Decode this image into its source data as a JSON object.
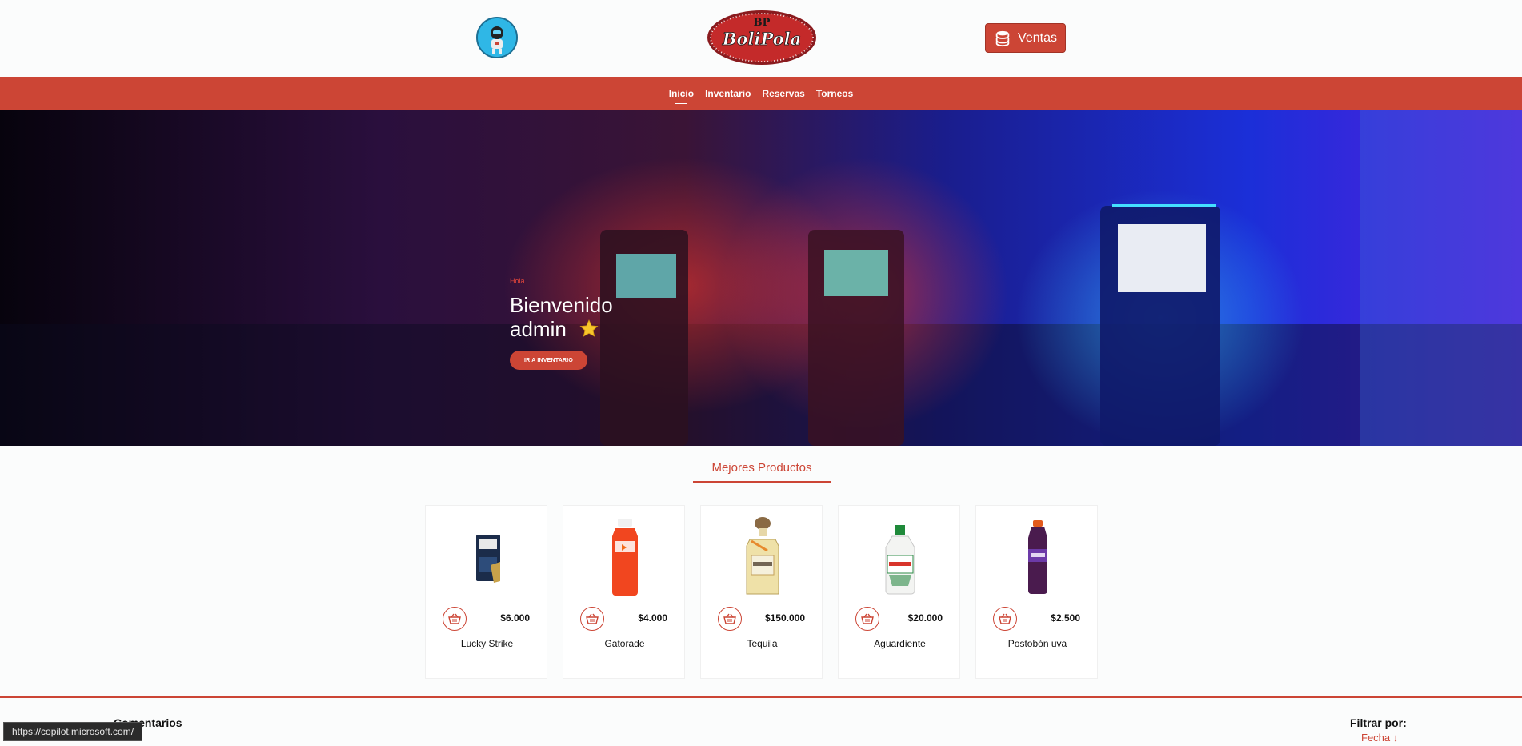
{
  "header": {
    "logo_text": "BoliPola",
    "logo_monogram": "BP",
    "sales_label": "Ventas"
  },
  "nav": {
    "items": [
      "Inicio",
      "Inventario",
      "Reservas",
      "Torneos"
    ],
    "active": "Inicio"
  },
  "hero": {
    "greeting": "Hola",
    "title_line1": "Bienvenido",
    "title_line2": "admin",
    "button_label": "IR A INVENTARIO"
  },
  "products_section": {
    "title": "Mejores Productos",
    "items": [
      {
        "name": "Lucky Strike",
        "price": "$6.000"
      },
      {
        "name": "Gatorade",
        "price": "$4.000"
      },
      {
        "name": "Tequila",
        "price": "$150.000"
      },
      {
        "name": "Aguardiente",
        "price": "$20.000"
      },
      {
        "name": "Postobón uva",
        "price": "$2.500"
      }
    ]
  },
  "comments": {
    "title": "Comentarios",
    "filter_label": "Filtrar por:",
    "filter_value": "Fecha ↓"
  },
  "status_bar": {
    "url": "https://copilot.microsoft.com/"
  },
  "colors": {
    "accent": "#cc4535",
    "background": "#fbfcfc"
  }
}
